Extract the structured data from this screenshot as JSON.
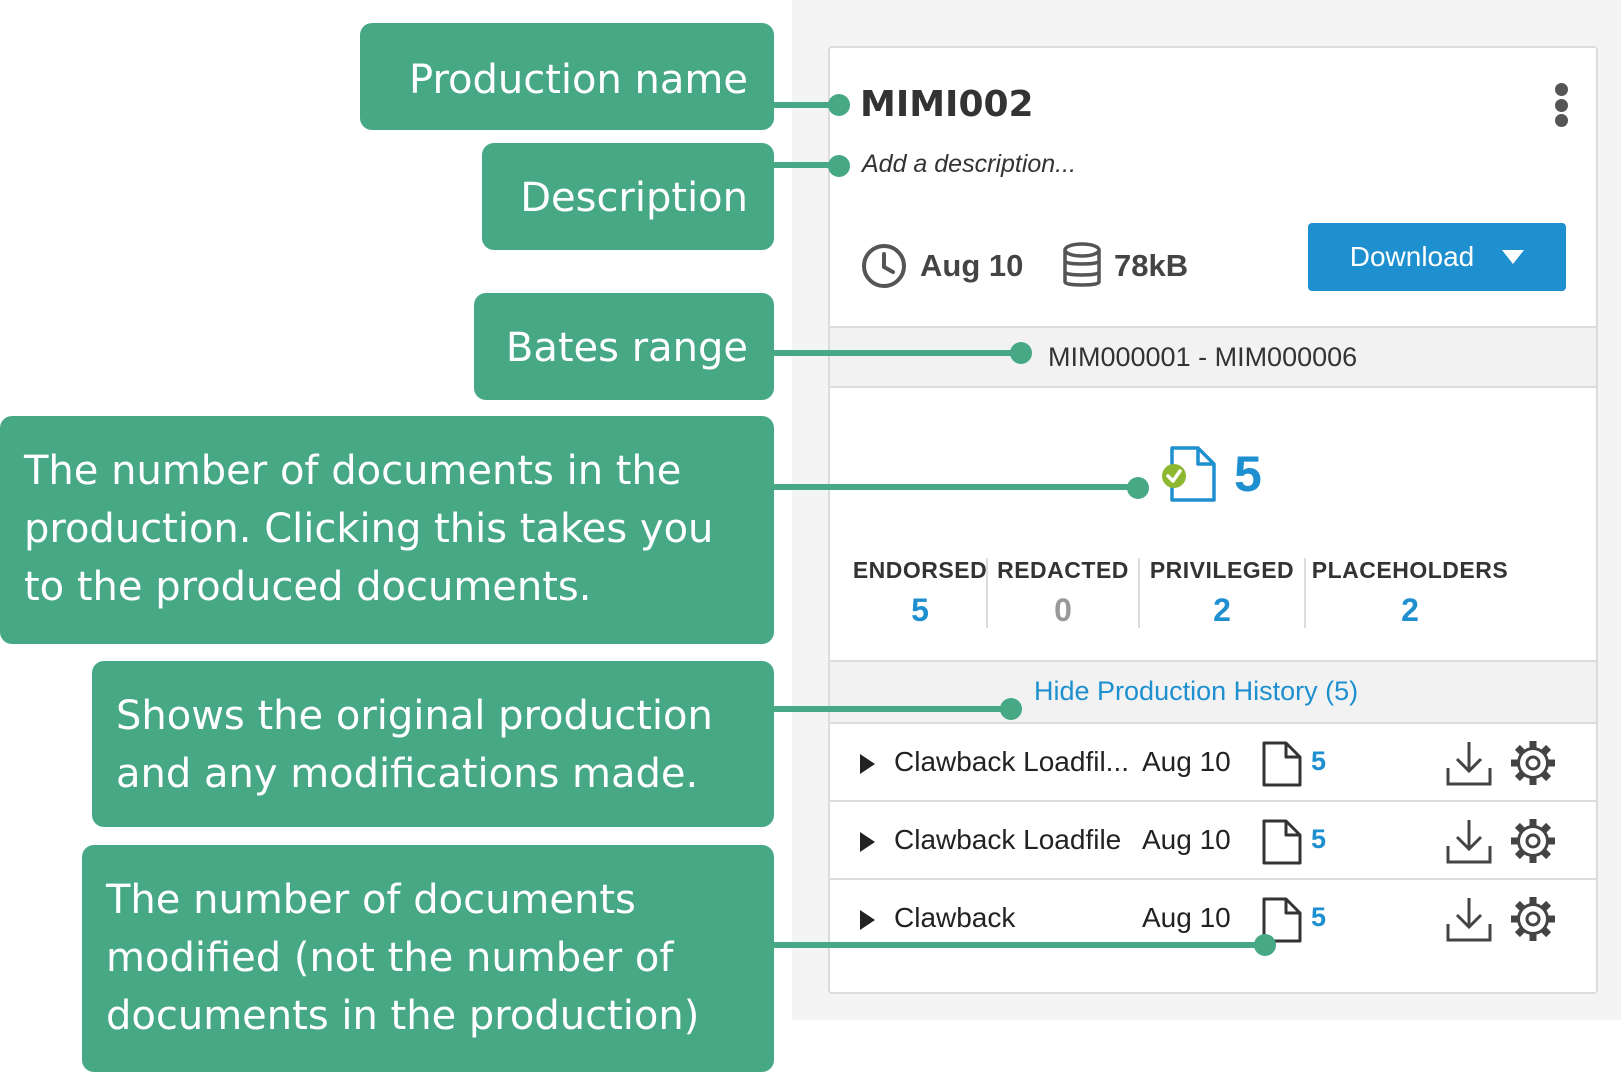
{
  "annotations": {
    "production_name": "Production name",
    "description": "Description",
    "bates_range": "Bates range",
    "doc_count_line1": "The number of documents in the",
    "doc_count_line2": "production. Clicking this takes you",
    "doc_count_line3": "to the produced documents.",
    "history_line1": "Shows the original production",
    "history_line2": "and any modifications made.",
    "modified_line1": "The number of documents",
    "modified_line2": "modified (not the number of",
    "modified_line3": "documents in the production)"
  },
  "card": {
    "title": "MIMI002",
    "description_placeholder": "Add a description...",
    "date": "Aug 10",
    "size": "78kB",
    "download_label": "Download",
    "bates": "MIM000001 - MIM000006",
    "doc_count": "5",
    "stats": [
      {
        "label": "ENDORSED",
        "value": "5"
      },
      {
        "label": "REDACTED",
        "value": "0"
      },
      {
        "label": "PRIVILEGED",
        "value": "2"
      },
      {
        "label": "PLACEHOLDERS",
        "value": "2"
      }
    ],
    "history_link": "Hide Production History (5)",
    "history_rows": [
      {
        "name": "Clawback Loadfil...",
        "date": "Aug 10",
        "count": "5"
      },
      {
        "name": "Clawback Loadfile",
        "date": "Aug 10",
        "count": "5"
      },
      {
        "name": "Clawback",
        "date": "Aug 10",
        "count": "5"
      }
    ]
  },
  "colors": {
    "accent": "#1e8fcf",
    "callout": "#46a885",
    "check": "#8db82f"
  },
  "icons": [
    "clock-icon",
    "database-icon",
    "file-check-icon",
    "file-icon",
    "download-icon",
    "gear-icon",
    "kebab-menu-icon",
    "caret-down-icon"
  ]
}
